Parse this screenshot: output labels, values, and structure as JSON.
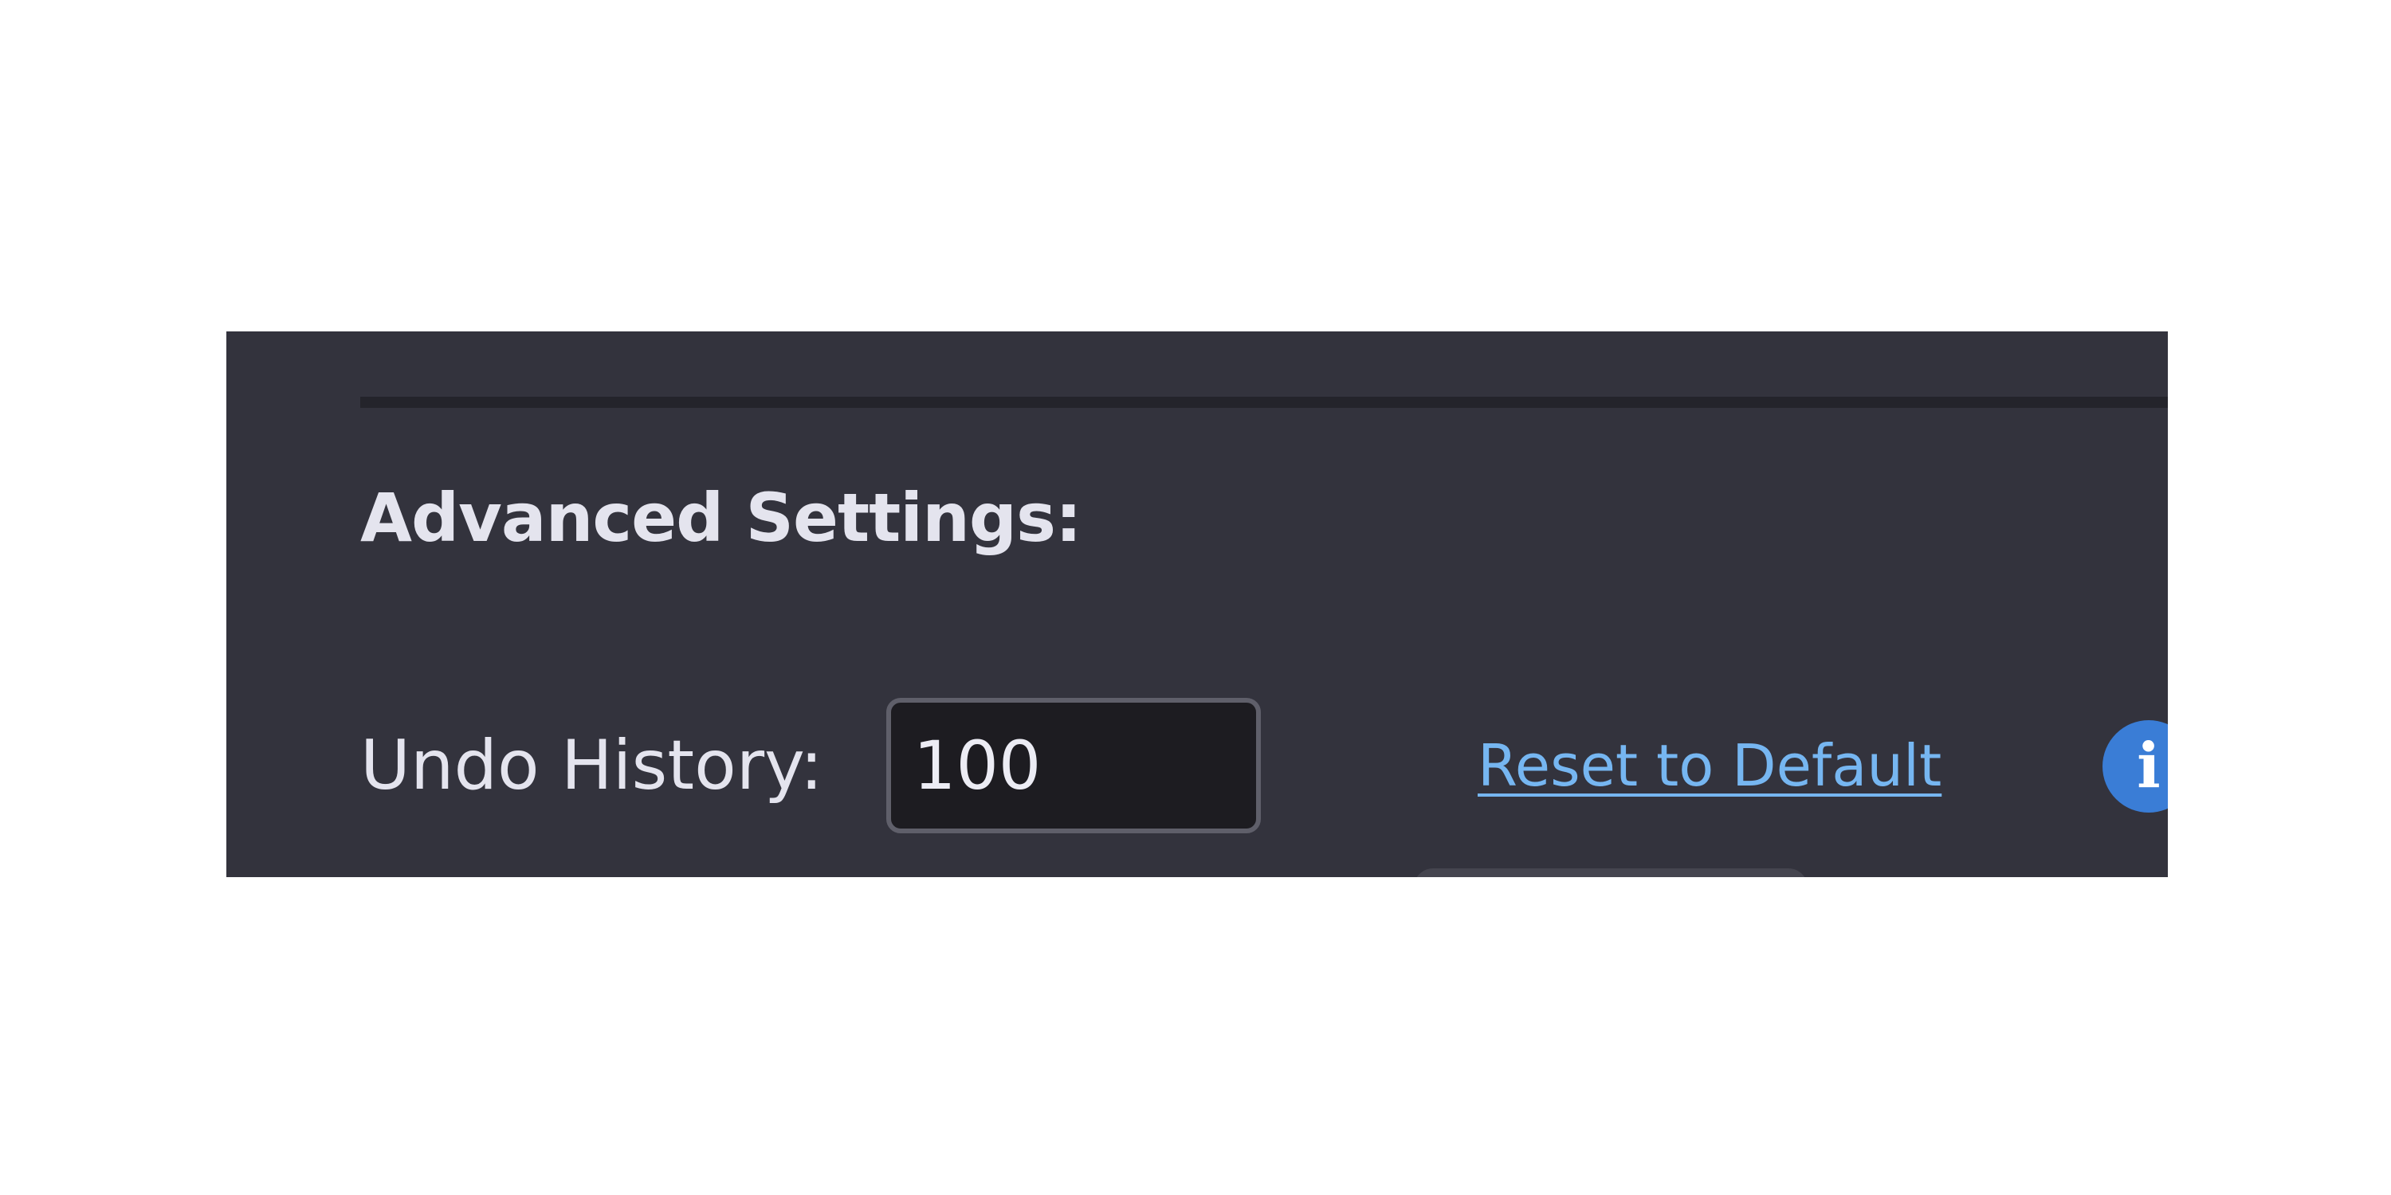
{
  "panel": {
    "section_title": "Advanced Settings:"
  },
  "undo_history": {
    "label": "Undo History:",
    "value": "100",
    "reset_label": "Reset to Default",
    "info_glyph": "i"
  },
  "colors": {
    "panel_background": "#33333d",
    "divider": "#24242b",
    "text": "#e4e4ee",
    "input_background": "#1d1c21",
    "input_border": "#5f5f6a",
    "link": "#76b6f1",
    "info_button": "#3a7dd6"
  },
  "icons": {
    "info": "info-icon"
  }
}
